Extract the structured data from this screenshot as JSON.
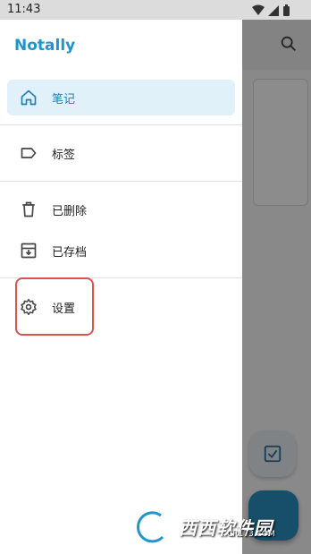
{
  "status_bar": {
    "time": "11:43"
  },
  "drawer": {
    "title": "Notally",
    "items": [
      {
        "label": "笔记",
        "icon": "home-icon",
        "active": true
      },
      {
        "label": "标签",
        "icon": "label-icon",
        "active": false
      },
      {
        "label": "已删除",
        "icon": "trash-icon",
        "active": false
      },
      {
        "label": "已存档",
        "icon": "archive-icon",
        "active": false
      },
      {
        "label": "设置",
        "icon": "gear-icon",
        "active": false
      }
    ]
  },
  "colors": {
    "accent": "#1f95cc",
    "active_bg": "#e1f1fa",
    "highlight": "#d9534f"
  },
  "watermark": {
    "text": "西西软件园",
    "sub": "CR173.COM"
  }
}
